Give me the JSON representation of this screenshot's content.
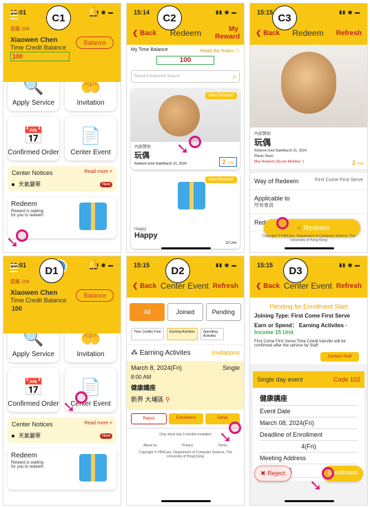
{
  "labels": {
    "c1": "C1",
    "c2": "C2",
    "c3": "C3",
    "d1": "D1",
    "d2": "D2",
    "d3": "D3"
  },
  "times": {
    "c1": "10:01",
    "c2": "15:14",
    "c3": "15:15",
    "d1": "10:01",
    "d2": "15:15",
    "d3": "15:15"
  },
  "home": {
    "uid": "頭層 104",
    "name": "Xiaowen Chen",
    "balance_label": "Time Credit Balance",
    "balance_value": "100",
    "balance_button": "Balance",
    "tiles": [
      "Apply Service",
      "Invitation",
      "Confirmed Order",
      "Center Event"
    ],
    "notices_title": "Center Notices",
    "read_more": "Read more >",
    "notice_item": "天氣嚴寒",
    "new_badge": "New",
    "redeem_title": "Redeem",
    "redeem_sub": "Reward is waiting for you to redeem"
  },
  "c2": {
    "back": "Back",
    "title": "Redeem",
    "right": "My Reward",
    "balance_label": "My Time Balance",
    "read_rules": "Read the Rules",
    "balance_value": "100",
    "search_placeholder": "Reward Keyword Search",
    "new_reward": "New Reward!",
    "item_cap": "內部贊助",
    "item_name": "玩偶",
    "item_date": "Redeem End DateMarch 31, 2024",
    "unit_value": "2",
    "unit_label": "Unit",
    "item2_cap": "Happy",
    "item2_name": "Happy",
    "item2_unit": "10 Unit"
  },
  "c3": {
    "back": "Back",
    "title": "Redeem",
    "right": "Refresh",
    "cap": "內部贊助",
    "name": "玩偶",
    "end_date": "Redeem End DateMarch 31, 2024",
    "stock": "Plenty Stock",
    "max": "Max Redeem Qty per Member: 1",
    "unit": "2",
    "unit_label": "Unit",
    "way_label": "Way of Redeem",
    "way_value": "First Come First Serve",
    "applicable_label": "Applicable to",
    "applicable_value": "所有會員",
    "detail_label": "Redeem Detail",
    "redeem_button": "Redeem",
    "footer": "Copyright © HINCare, Department of Computer Science, The University of Hong Kong"
  },
  "d2": {
    "back": "Back",
    "title": "Center Event",
    "right": "Refresh",
    "tabs": [
      "All",
      "Joined",
      "Pending"
    ],
    "chips": [
      "Time Credits Free",
      "Earning Activites",
      "Spending Activites"
    ],
    "section": "Earning Activites",
    "section_right": "Invitations",
    "date": "March 8, 2024(Fri)",
    "date_right": "Single",
    "time": "8:00 AM",
    "event": "健康講座",
    "place": "新界 大埔區",
    "buttons": [
      "Reject",
      "Enrollment",
      "Detail"
    ],
    "note": "Only show last 3 months invitation",
    "links": [
      "About us",
      "Privacy",
      "Terms"
    ],
    "footer": "Copyright © HINCare, Department of Computer Science, The University of Hong Kong"
  },
  "d3": {
    "back": "Back",
    "title": "Center Event",
    "right": "Refresh",
    "pending": "Pending for Enrollment Start",
    "joining": "Joining Type: First Come First Serve",
    "earn": "Earn or Spend： Earning Activites ·",
    "income": "Income 15 Unit",
    "desc": "First Come First Serve,Time Creidt transfer will be confirmed after the service by Staff",
    "contact": "Contact Staff",
    "sde": "Single day event",
    "code": "Code 102",
    "event": "健康講座",
    "event_date_label": "Event Date",
    "event_date": "March 08, 2024(Fri)",
    "deadline_label": "Deadline of Enrollment",
    "deadline_partial": "4(Fri)",
    "meeting_label": "Meeting Address",
    "meeting_value": "新界 大埔區",
    "reject": "Reject",
    "enroll": "Enrollment"
  }
}
